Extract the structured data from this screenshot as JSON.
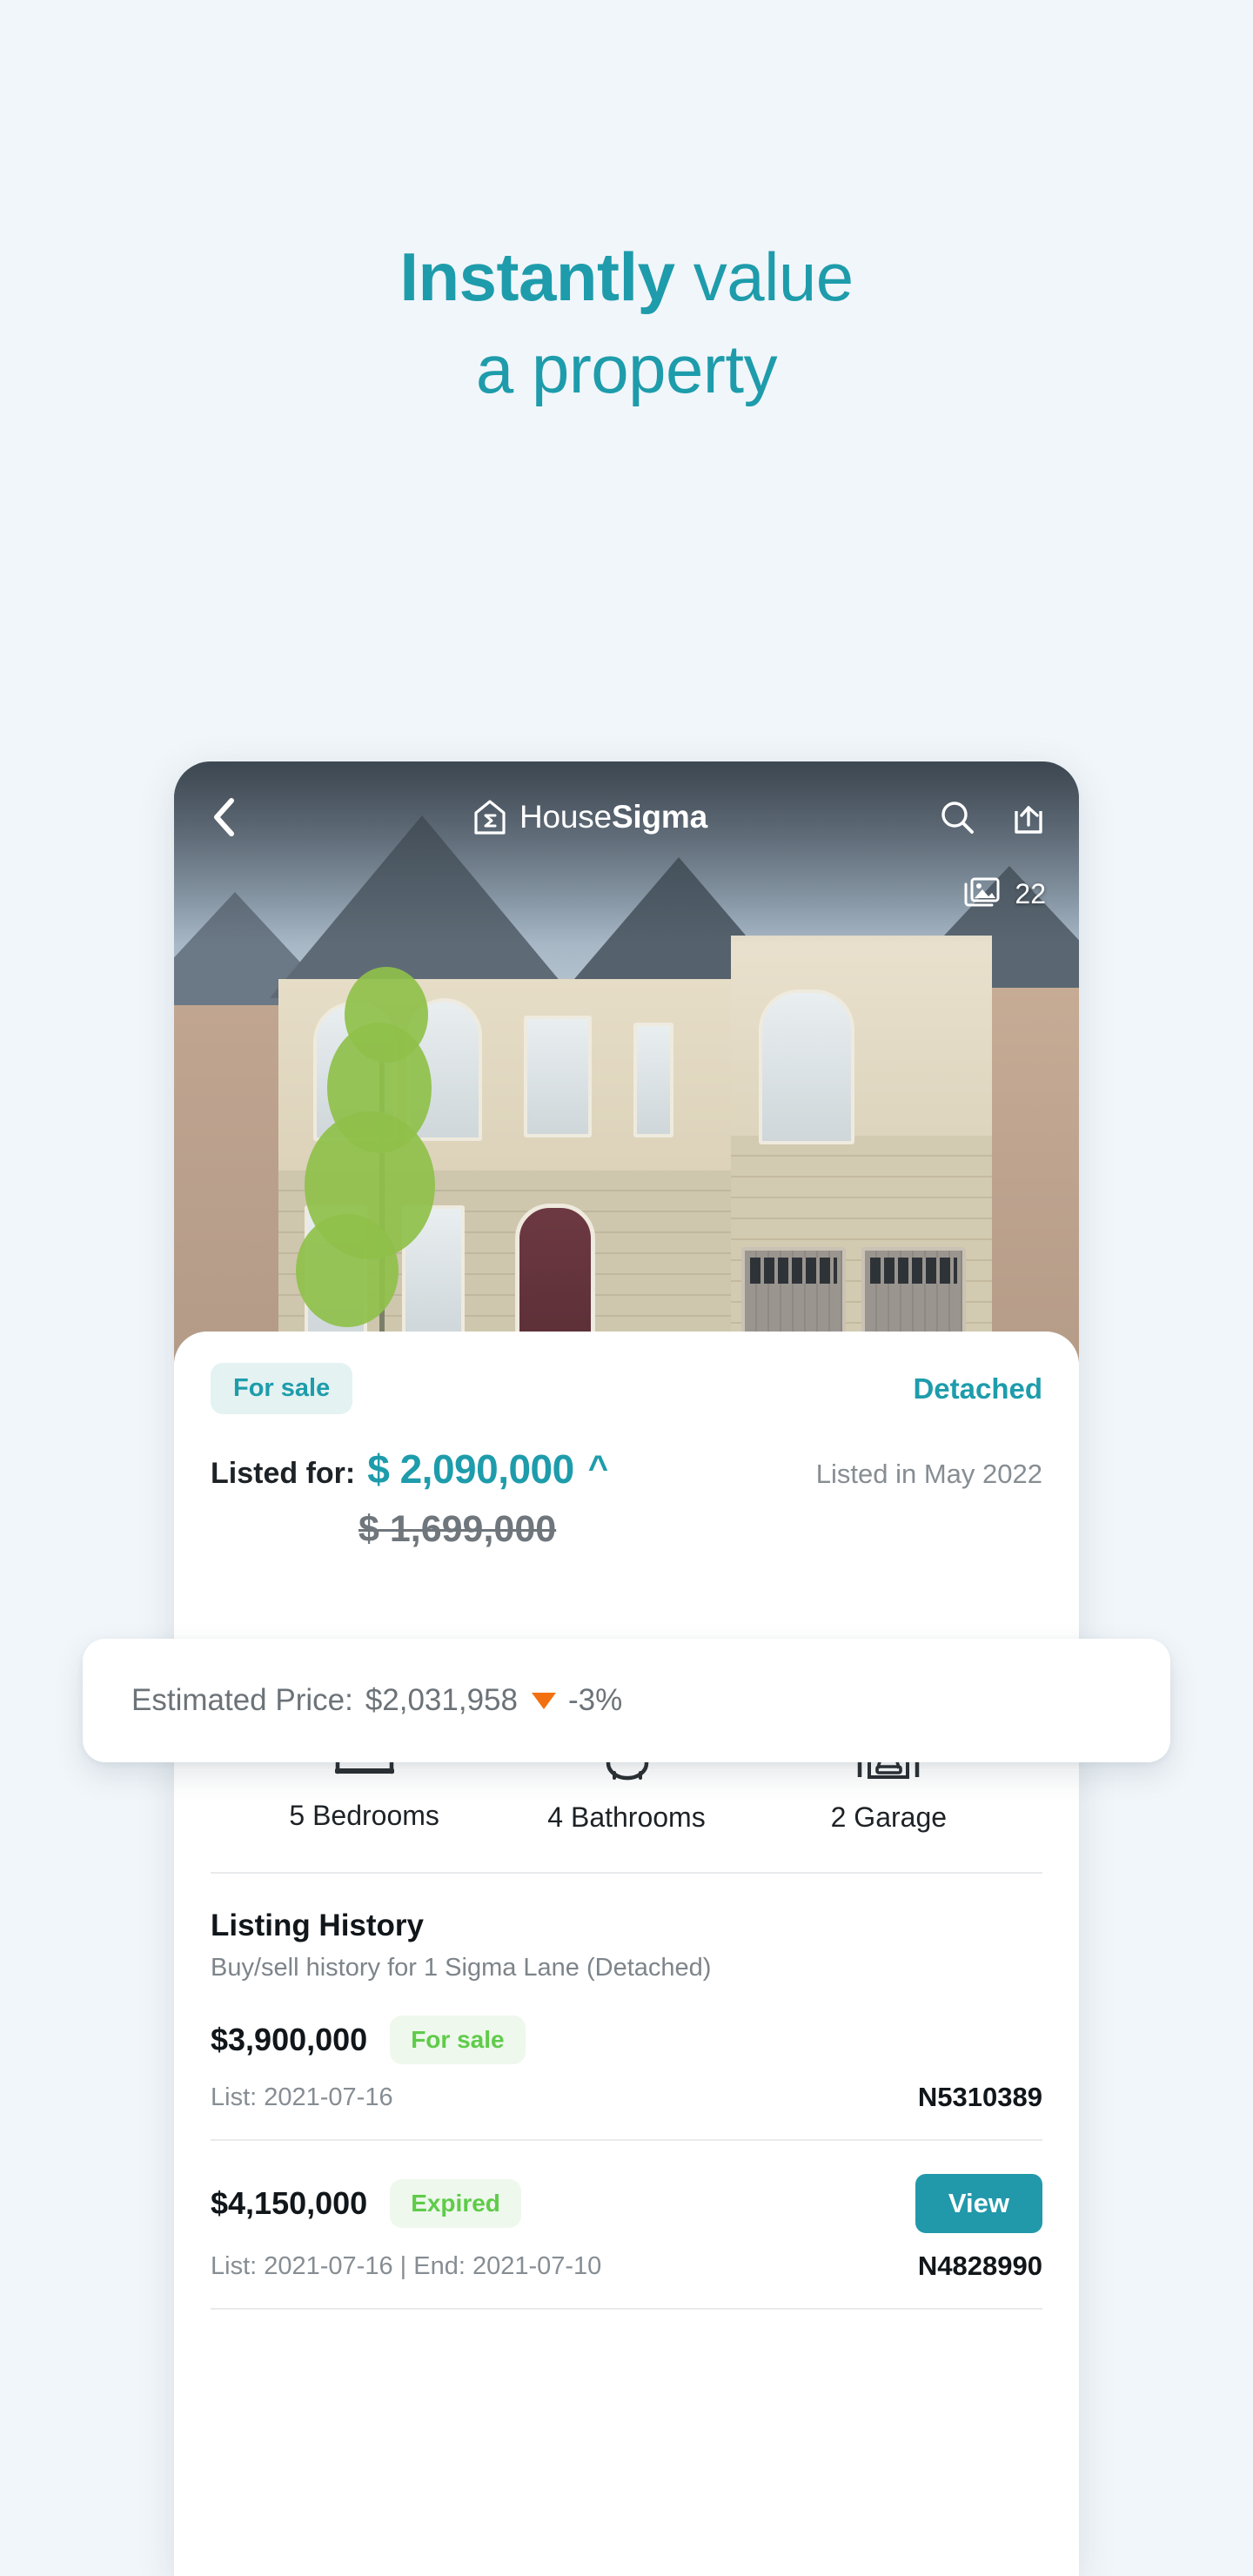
{
  "headline": {
    "line1_strong": "Instantly",
    "line1_rest": " value",
    "line2": "a property"
  },
  "app": {
    "back_icon": "chevron-left-icon",
    "brand_light": "House",
    "brand_bold": "Sigma",
    "logo_icon": "house-sigma-logo-icon",
    "search_icon": "search-icon",
    "share_icon": "share-icon",
    "gallery_icon": "photo-gallery-icon",
    "photo_count": "22"
  },
  "listing": {
    "status_badge": "For sale",
    "property_type": "Detached",
    "price_label": "Listed for:",
    "price": "$ 2,090,000",
    "price_caret": "caret-up-icon",
    "listed_in": "Listed in May 2022",
    "previous_price": "$ 1,699,000"
  },
  "estimate": {
    "label": "Estimated Price:",
    "value": "$2,031,958",
    "trend_icon": "triangle-down-icon",
    "change": "-3%",
    "trend_color": "#f2700f"
  },
  "features": [
    {
      "icon": "bed-icon",
      "label": "5 Bedrooms"
    },
    {
      "icon": "bathtub-icon",
      "label": "4 Bathrooms"
    },
    {
      "icon": "garage-icon",
      "label": "2 Garage"
    }
  ],
  "history": {
    "title": "Listing History",
    "subtitle": "Buy/sell history for 1 Sigma Lane (Detached)",
    "rows": [
      {
        "price": "$3,900,000",
        "status": "For sale",
        "dates": "List: 2021-07-16",
        "mls": "N5310389",
        "action": ""
      },
      {
        "price": "$4,150,000",
        "status": "Expired",
        "dates": "List: 2021-07-16 | End: 2021-07-10",
        "mls": "N4828990",
        "action": "View"
      }
    ]
  },
  "colors": {
    "background": "#f1f6fa",
    "teal": "#1e9cab",
    "teal_button": "#2299aa",
    "badge_teal_bg": "#e4f2f2",
    "badge_green_bg": "#eef8ec",
    "badge_green_text": "#5fcb4a",
    "orange": "#f2700f"
  }
}
